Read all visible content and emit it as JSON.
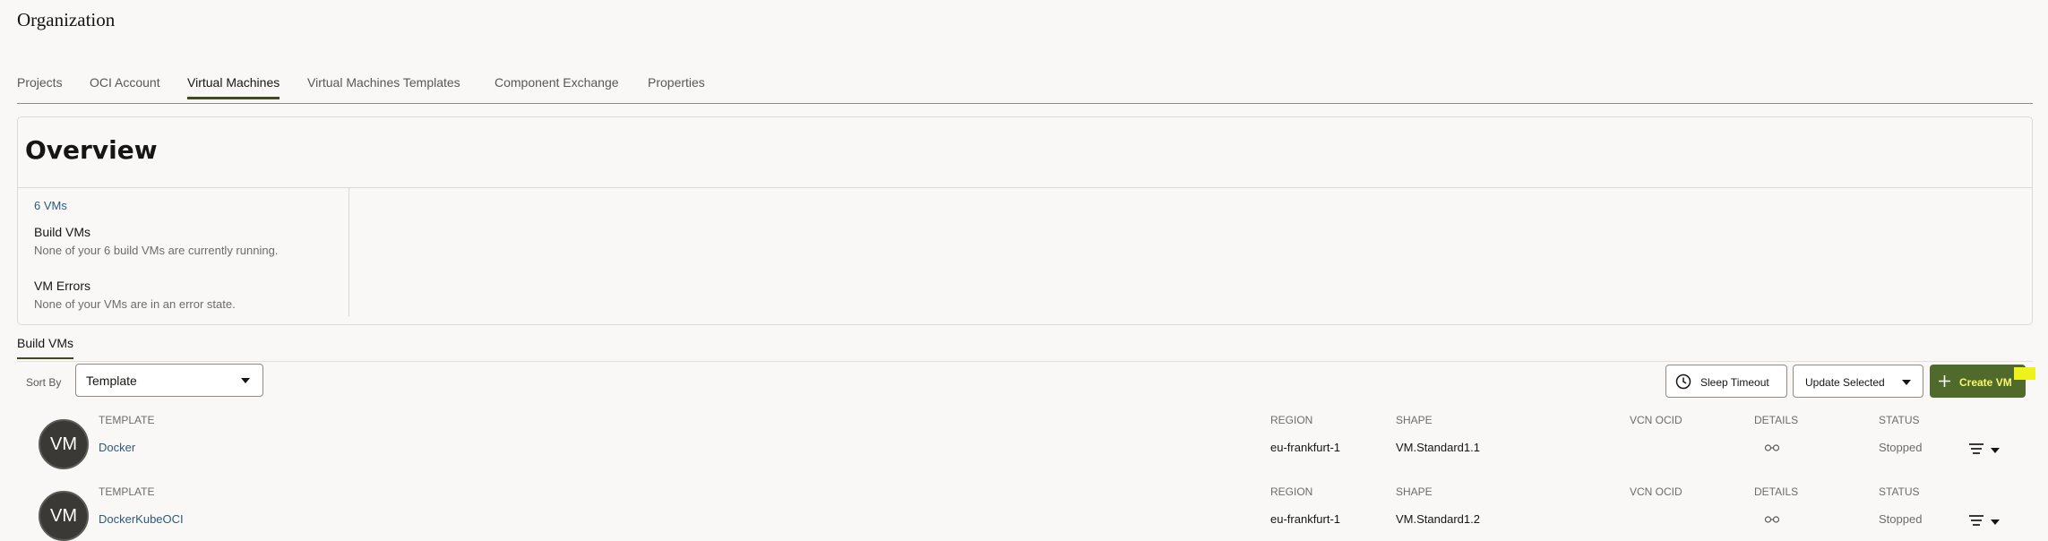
{
  "page": {
    "title": "Organization"
  },
  "tabs": [
    {
      "label": "Projects"
    },
    {
      "label": "OCI Account"
    },
    {
      "label": "Virtual Machines",
      "active": true
    },
    {
      "label": "Virtual Machines Templates"
    },
    {
      "label": "Component Exchange"
    },
    {
      "label": "Properties"
    }
  ],
  "overview": {
    "title": "Overview",
    "vm_count": "6 VMs",
    "build_heading": "Build VMs",
    "build_text": "None of your 6 build VMs are currently running.",
    "errors_heading": "VM Errors",
    "errors_text": "None of your VMs are in an error state."
  },
  "subtab": {
    "label": "Build VMs"
  },
  "toolbar": {
    "sort_label": "Sort By",
    "sort_value": "Template",
    "sleep_label": "Sleep Timeout",
    "update_label": "Update Selected",
    "create_label": "Create VM"
  },
  "columns": {
    "template": "TEMPLATE",
    "region": "REGION",
    "shape": "SHAPE",
    "vcn": "VCN OCID",
    "details": "DETAILS",
    "status": "STATUS"
  },
  "vms": [
    {
      "avatar": "VM",
      "template": "Docker",
      "region": "eu-frankfurt-1",
      "shape": "VM.Standard1.1",
      "vcn": "",
      "status": "Stopped"
    },
    {
      "avatar": "VM",
      "template": "DockerKubeOCI",
      "region": "eu-frankfurt-1",
      "shape": "VM.Standard1.2",
      "vcn": "",
      "status": "Stopped"
    }
  ],
  "colors": {
    "accent": "#4f6a2a",
    "link": "#2b5a7a",
    "create_text": "#f8f86a",
    "highlight": "#eef21a"
  },
  "icons": {
    "sleep": "clock-icon",
    "create": "plus-icon",
    "details": "glasses-icon",
    "row_menu": "hamburger-menu-icon"
  }
}
